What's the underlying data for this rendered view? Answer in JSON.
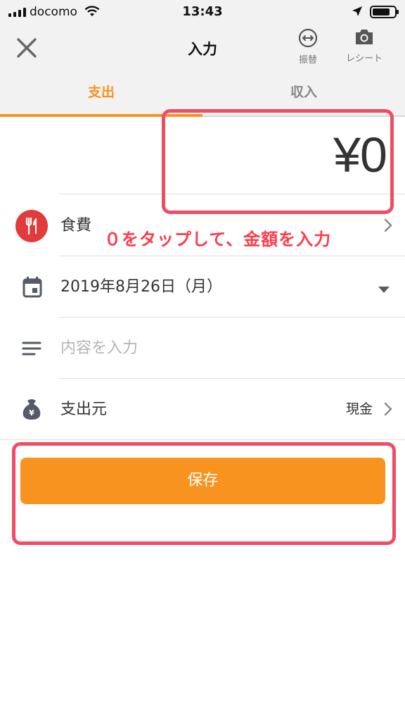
{
  "status_bar": {
    "carrier": "docomo",
    "time": "13:43"
  },
  "header": {
    "title": "入力",
    "transfer_label": "振替",
    "receipt_label": "レシート",
    "icons": {
      "close": "close-icon",
      "transfer": "transfer-arrows-icon",
      "receipt": "camera-icon"
    }
  },
  "tabs": [
    {
      "label": "支出",
      "active": true
    },
    {
      "label": "収入",
      "active": false
    }
  ],
  "amount": "¥0",
  "form": {
    "category": {
      "label": "食費",
      "icon": "fork-knife-icon",
      "color": "#e23b3b"
    },
    "date": {
      "label": "2019年8月26日（月）",
      "icon": "calendar-icon"
    },
    "memo": {
      "placeholder": "内容を入力",
      "icon": "lines-icon"
    },
    "source": {
      "label": "支出元",
      "value": "現金",
      "icon": "money-bag-icon"
    }
  },
  "save_button": {
    "label": "保存"
  },
  "annotation": {
    "text": "０をタップして、金額を入力"
  },
  "colors": {
    "accent": "#f7931e",
    "category_red": "#e23b3b",
    "highlight": "#ef4d63",
    "annotation": "#ff3b4a"
  }
}
